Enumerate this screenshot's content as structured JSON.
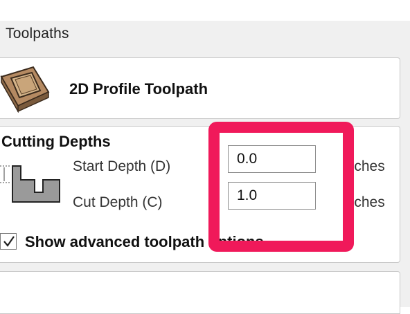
{
  "panel": {
    "title": "Toolpaths"
  },
  "toolpath": {
    "title": "2D Profile Toolpath",
    "icon": "profile-toolpath-icon"
  },
  "cutting_depths": {
    "section_title": "Cutting Depths",
    "start_depth": {
      "label": "Start Depth (D)",
      "value": "0.0",
      "unit": "inches"
    },
    "cut_depth": {
      "label": "Cut Depth (C)",
      "value": "1.0",
      "unit": "inches"
    }
  },
  "advanced_options": {
    "label": "Show advanced toolpath options",
    "checked": true
  },
  "colors": {
    "highlight": "#f0195a",
    "panel_bg": "#f0f0f0"
  }
}
